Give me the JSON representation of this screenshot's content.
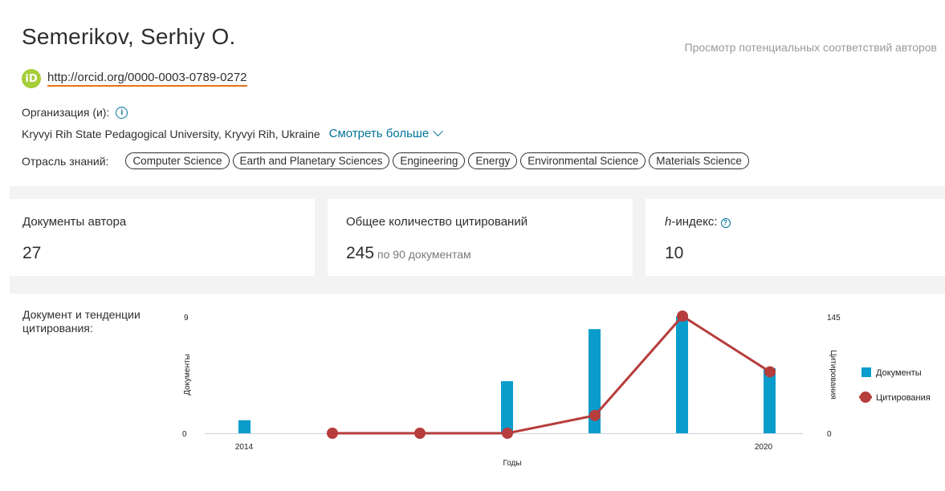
{
  "author": {
    "name": "Semerikov, Serhiy O.",
    "potential_matches_link": "Просмотр потенциальных соответствий авторов",
    "orcid_icon_text": "iD",
    "orcid_url": "http://orcid.org/0000-0003-0789-0272",
    "organization_label": "Организация (и):",
    "organization": "Kryvyi Rih State Pedagogical University, Kryvyi Rih, Ukraine",
    "see_more": "Смотреть больше",
    "subject_label": "Отрасль знаний:",
    "subjects": [
      "Computer Science",
      "Earth and Planetary Sciences",
      "Engineering",
      "Energy",
      "Environmental Science",
      "Materials Science"
    ]
  },
  "metrics": {
    "documents": {
      "title": "Документы автора",
      "value": "27"
    },
    "citations": {
      "title": "Общее количество цитирований",
      "value": "245",
      "sub": "по 90 документам"
    },
    "hindex": {
      "title_italic": "h",
      "title_rest": "-индекс:",
      "value": "10"
    }
  },
  "trend": {
    "title": "Документ и тенденции цитирования:"
  },
  "colors": {
    "bar": "#0a9dcc",
    "line": "#b73c3c",
    "link": "#007398",
    "orcid": "#a6ce39",
    "underline": "#e9711c"
  },
  "chart_data": {
    "type": "bar",
    "x": [
      2014,
      2015,
      2016,
      2017,
      2018,
      2019,
      2020
    ],
    "x_tick_labels": [
      "2014",
      "2020"
    ],
    "xlabel": "Годы",
    "ylabel_left": "Документы",
    "ylabel_right": "Цитирования",
    "ylim_left": [
      0,
      9
    ],
    "ylim_right": [
      0,
      145
    ],
    "grid": false,
    "legend_position": "right",
    "series": [
      {
        "name": "Документы",
        "type": "bar",
        "axis": "left",
        "values": [
          1,
          0,
          0,
          4,
          8,
          9,
          5
        ]
      },
      {
        "name": "Цитирования",
        "type": "line",
        "axis": "right",
        "values": [
          null,
          0,
          0,
          0,
          22,
          145,
          76
        ]
      }
    ]
  }
}
